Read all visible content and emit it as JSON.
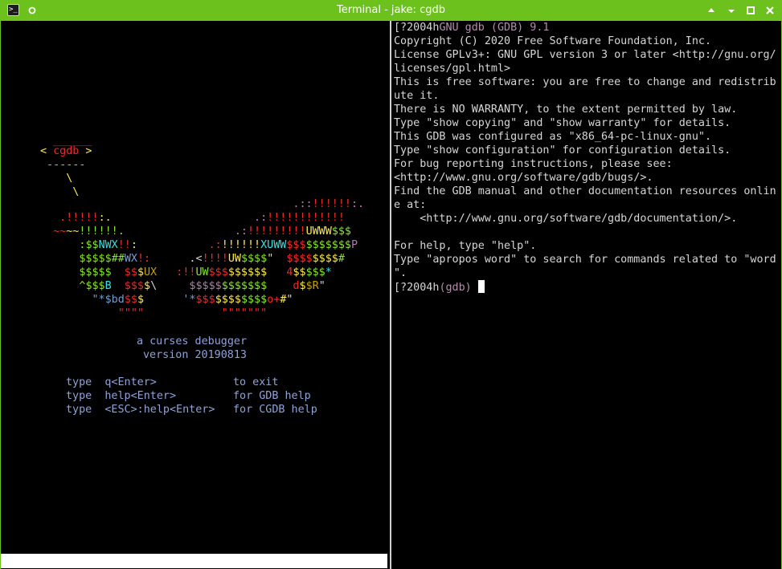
{
  "window": {
    "title": "Terminal - jake: cgdb",
    "buttons": [
      "arrow-up-icon",
      "minimize-icon",
      "maximize-icon",
      "close-icon"
    ],
    "title_bar_color": "#6cc11d"
  },
  "splash": {
    "logo_line1": " ______",
    "logo_line2_open": "< ",
    "logo_name": "cgdb",
    "logo_line2_close": " >",
    "logo_line3": " ------",
    "logo_line4": "    \\",
    "logo_line5": "     \\",
    "tagline": "a curses debugger",
    "version": "version 20190813",
    "help_rows": [
      {
        "word": "type",
        "key": "q<Enter>",
        "action": "to exit"
      },
      {
        "word": "type",
        "key": "help<Enter>",
        "action": "for GDB help"
      },
      {
        "word": "type",
        "key": "<ESC>:help<Enter>",
        "action": "for CGDB help"
      }
    ]
  },
  "ascii_art": [
    [
      {
        "t": "                                       .::",
        "c": "m"
      },
      {
        "t": "!!!!!!",
        "c": "r"
      },
      {
        "t": ":.",
        "c": "m"
      }
    ],
    [
      {
        "t": "   .",
        "c": "r"
      },
      {
        "t": "!!!!!",
        "c": "r"
      },
      {
        "t": ":.",
        "c": "y"
      },
      {
        "t": "                      .:",
        "c": "m"
      },
      {
        "t": "!!!!!!!!!!!!",
        "c": "r"
      }
    ],
    [
      {
        "t": "  ~~",
        "c": "r"
      },
      {
        "t": "~~",
        "c": "y"
      },
      {
        "t": "!!!!!!.",
        "c": "g"
      },
      {
        "t": "                 .:",
        "c": "m"
      },
      {
        "t": "!!!!!!!!!",
        "c": "r"
      },
      {
        "t": "UWWW",
        "c": "y"
      },
      {
        "t": "$$$",
        "c": "g"
      }
    ],
    [
      {
        "t": "      :",
        "c": "g"
      },
      {
        "t": "$$",
        "c": "g"
      },
      {
        "t": "NWX",
        "c": "c"
      },
      {
        "t": "!!",
        "c": "r"
      },
      {
        "t": ":",
        "c": "y"
      },
      {
        "t": "           .:",
        "c": "r"
      },
      {
        "t": "!!!!!!",
        "c": "y"
      },
      {
        "t": "XUWW",
        "c": "c"
      },
      {
        "t": "$$$",
        "c": "r"
      },
      {
        "t": "$$$$$$$",
        "c": "g"
      },
      {
        "t": "P",
        "c": "m"
      }
    ],
    [
      {
        "t": "      $$$$$",
        "c": "g"
      },
      {
        "t": "##",
        "c": "g"
      },
      {
        "t": "WX",
        "c": "b"
      },
      {
        "t": "!:",
        "c": "r"
      },
      {
        "t": "      .<",
        "c": "wt"
      },
      {
        "t": "!!!!",
        "c": "r"
      },
      {
        "t": "UW",
        "c": "y"
      },
      {
        "t": "$$$$",
        "c": "g"
      },
      {
        "t": "\"",
        "c": "wt"
      },
      {
        "t": "  $$$$",
        "c": "r"
      },
      {
        "t": "$$$$",
        "c": "y"
      },
      {
        "t": "#",
        "c": "g"
      }
    ],
    [
      {
        "t": "      $$$$$",
        "c": "g"
      },
      {
        "t": "  $$",
        "c": "r"
      },
      {
        "t": "$",
        "c": "y"
      },
      {
        "t": "UX",
        "c": "o"
      },
      {
        "t": "   :!!",
        "c": "r"
      },
      {
        "t": "UW",
        "c": "g"
      },
      {
        "t": "$$$",
        "c": "r"
      },
      {
        "t": "$$$$$$",
        "c": "y"
      },
      {
        "t": "   4",
        "c": "r"
      },
      {
        "t": "$$",
        "c": "y"
      },
      {
        "t": "$$$",
        "c": "g"
      },
      {
        "t": "*",
        "c": "c"
      }
    ],
    [
      {
        "t": "      ^",
        "c": "g"
      },
      {
        "t": "$$$",
        "c": "g"
      },
      {
        "t": "B",
        "c": "c"
      },
      {
        "t": "  $$$",
        "c": "r"
      },
      {
        "t": "$",
        "c": "y"
      },
      {
        "t": "\\",
        "c": "wt"
      },
      {
        "t": "     $$$$$",
        "c": "m"
      },
      {
        "t": "$$$$$$$",
        "c": "g"
      },
      {
        "t": "    d",
        "c": "r"
      },
      {
        "t": "$",
        "c": "y"
      },
      {
        "t": "$R",
        "c": "o"
      },
      {
        "t": "\"",
        "c": "wt"
      }
    ],
    [
      {
        "t": "        \"*",
        "c": "b"
      },
      {
        "t": "$bd",
        "c": "b"
      },
      {
        "t": "$$",
        "c": "r"
      },
      {
        "t": "$",
        "c": "y"
      },
      {
        "t": "      '*",
        "c": "b"
      },
      {
        "t": "$$$",
        "c": "r"
      },
      {
        "t": "$$$$",
        "c": "y"
      },
      {
        "t": "$$$$",
        "c": "g"
      },
      {
        "t": "o+",
        "c": "r"
      },
      {
        "t": "#",
        "c": "y"
      },
      {
        "t": "\"",
        "c": "wt"
      }
    ],
    [
      {
        "t": "            \"\"\"\"",
        "c": "r"
      },
      {
        "t": "            \"\"\"\"\"\"\"",
        "c": "r"
      }
    ]
  ],
  "gdb": {
    "prefix": "[?2004h",
    "banner": "GNU gdb (GDB) 9.1",
    "lines": [
      "Copyright (C) 2020 Free Software Foundation, Inc.",
      "License GPLv3+: GNU GPL version 3 or later <http://gnu.org/",
      "licenses/gpl.html>",
      "This is free software: you are free to change and redistrib",
      "ute it.",
      "There is NO WARRANTY, to the extent permitted by law.",
      "Type \"show copying\" and \"show warranty\" for details.",
      "This GDB was configured as \"x86_64-pc-linux-gnu\".",
      "Type \"show configuration\" for configuration details.",
      "For bug reporting instructions, please see:",
      "<http://www.gnu.org/software/gdb/bugs/>.",
      "Find the GDB manual and other documentation resources onlin",
      "e at:",
      "    <http://www.gnu.org/software/gdb/documentation/>.",
      "",
      "For help, type \"help\".",
      "Type \"apropos word\" to search for commands related to \"word",
      "\"."
    ],
    "prompt_prefix": "[?2004h",
    "prompt": "(gdb)"
  }
}
